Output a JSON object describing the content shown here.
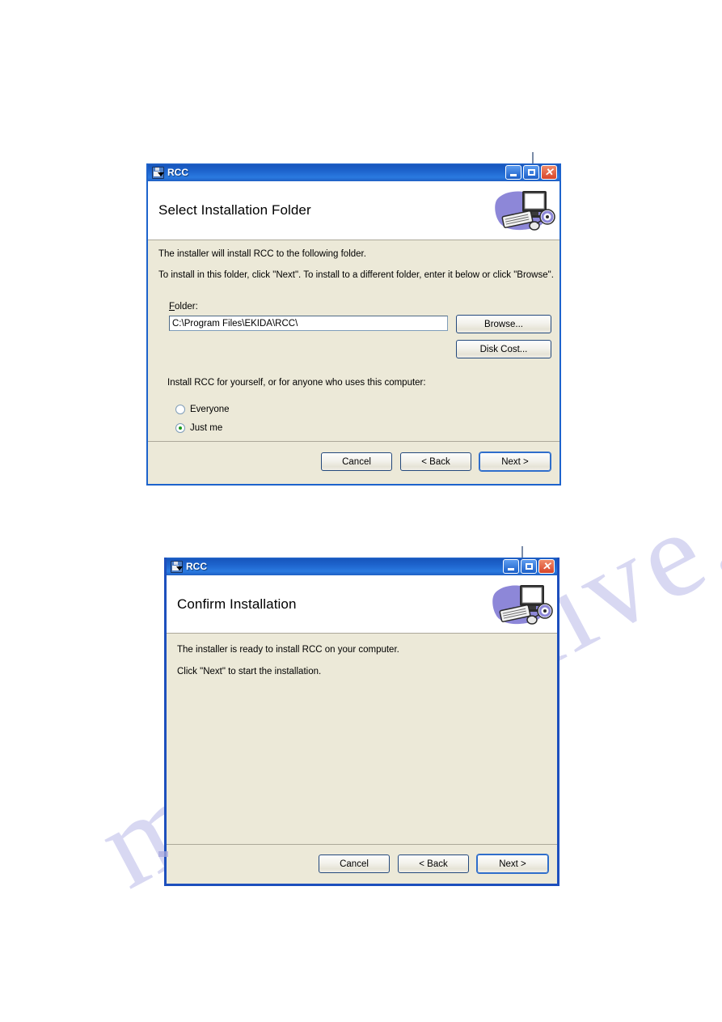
{
  "page": {
    "watermark_text": "manualshive.com"
  },
  "dialogs": [
    {
      "title": "RCC",
      "title_icon": "installer-floppy-icon",
      "header": "Select Installation Folder",
      "header_art": "computer-setup-icon",
      "caption_buttons": {
        "minimize": "minimize-icon",
        "maximize": "maximize-icon",
        "close": "close-icon",
        "close_glyph": "✕"
      },
      "body": {
        "line1": "The installer will install RCC to the following folder.",
        "line2": "To install in this folder, click \"Next\".  To install to a different folder, enter it below or click \"Browse\".",
        "folder_label_accel": "F",
        "folder_label_rest": "older:",
        "folder_value": "C:\\Program Files\\EKIDA\\RCC\\",
        "browse_label": "Browse...",
        "disk_cost_label": "Disk Cost...",
        "scope_prompt": "Install RCC for yourself, or for anyone who uses this computer:",
        "radios": [
          {
            "label": "Everyone",
            "checked": false
          },
          {
            "label": "Just me",
            "checked": true
          }
        ]
      },
      "footer": {
        "cancel": "Cancel",
        "back": "< Back",
        "next": "Next >",
        "default_button": "Next >"
      }
    },
    {
      "title": "RCC",
      "title_icon": "installer-floppy-icon",
      "header": "Confirm Installation",
      "header_art": "computer-setup-icon",
      "caption_buttons": {
        "minimize": "minimize-icon",
        "maximize": "maximize-icon",
        "close": "close-icon",
        "close_glyph": "✕"
      },
      "body": {
        "line1": "The installer is ready to install RCC on your computer.",
        "line2": "Click \"Next\" to start the installation."
      },
      "footer": {
        "cancel": "Cancel",
        "back": "< Back",
        "next": "Next >",
        "default_button": "Next >"
      }
    }
  ]
}
